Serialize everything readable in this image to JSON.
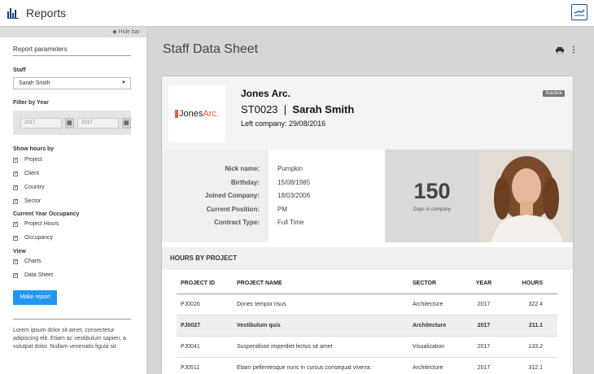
{
  "app": {
    "title": "Reports"
  },
  "sidebar": {
    "hide_bar": "Hide bar",
    "title": "Report parameters",
    "staff_label": "Staff",
    "staff_value": "Sarah Smith",
    "filter_label": "Filter by Year",
    "year_from": "2017",
    "year_to": "2017",
    "show_hours_label": "Show hours by",
    "show_hours": [
      "Project",
      "Client",
      "Country",
      "Sector"
    ],
    "occupancy_label": "Current Year Occupancy",
    "occupancy": [
      "Project Hours",
      "Occupancy"
    ],
    "view_label": "View",
    "view": [
      "Charts",
      "Data Sheet"
    ],
    "make_report": "Make report",
    "lorem": "Lorem ipsum dolor sit amet, consectetur adipiscing elit. Etiam ac vestibulum sapien, a volutpat dolor. Nullam venenatis ligula sit"
  },
  "main": {
    "title": "Staff Data Sheet",
    "company": "Jones Arc.",
    "logo_text_1": "Jones",
    "logo_text_2": "Arc.",
    "staff_id": "ST0023",
    "separator": "|",
    "staff_name": "Sarah Smith",
    "left_company_label": "Left company:",
    "left_company_date": "29/08/2016",
    "status": "Inactive",
    "info": [
      {
        "label": "Nick name:",
        "value": "Pumpkin"
      },
      {
        "label": "Birthday:",
        "value": "15/08/1985"
      },
      {
        "label": "Joined Company:",
        "value": "18/03/2006"
      },
      {
        "label": "Current Position:",
        "value": "PM"
      },
      {
        "label": "Contract Type:",
        "value": "Full Time"
      }
    ],
    "days_value": "150",
    "days_caption": "Days in company",
    "hours_section": "HOURS BY PROJECT",
    "table": {
      "headers": [
        "PROJECT ID",
        "PROJECT NAME",
        "SECTOR",
        "YEAR",
        "HOURS"
      ],
      "rows": [
        [
          "PJ0026",
          "Donec tempor risus",
          "Architecture",
          "2017",
          "322.4"
        ],
        [
          "PJ0027",
          "Vestibulum quis",
          "Architecture",
          "2017",
          "211.1"
        ],
        [
          "PJ0041",
          "Suspendisse imperdiet lectus sit amet",
          "Visualization",
          "2017",
          "133.2"
        ],
        [
          "PJ0511",
          "Etiam pellentesque nunc in cursus consequat viverra.",
          "Architecture",
          "2017",
          "312.1"
        ]
      ]
    }
  },
  "colors": {
    "accent": "#2196f3",
    "brand_logo": "#e05c3a",
    "badge": "#777777"
  }
}
